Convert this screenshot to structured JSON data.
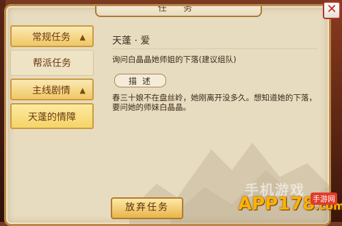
{
  "window": {
    "title": "任 务",
    "close_label": "✕"
  },
  "menu": {
    "categories": [
      {
        "label": "常规任务",
        "expanded": true,
        "children": [
          "帮派任务"
        ]
      },
      {
        "label": "主线剧情",
        "expanded": true,
        "children": [
          "天蓬的情障"
        ]
      }
    ]
  },
  "quest": {
    "title": "天蓬 · 爱",
    "goal": "询问白晶晶她师姐的下落(建议组队)",
    "desc_tab": "描述",
    "description": "春三十娘不在盘丝岭，她刚离开没多久。想知道她的下落，要问她的师妹白晶晶。"
  },
  "actions": {
    "abandon_label": "放弃任务"
  },
  "watermark": {
    "top": "手机游戏",
    "main": "APP178",
    "suffix": ".com",
    "badge": "手游网"
  },
  "colors": {
    "accent": "#f0c865",
    "close": "#c0261c",
    "watermark": "#ffb200"
  }
}
